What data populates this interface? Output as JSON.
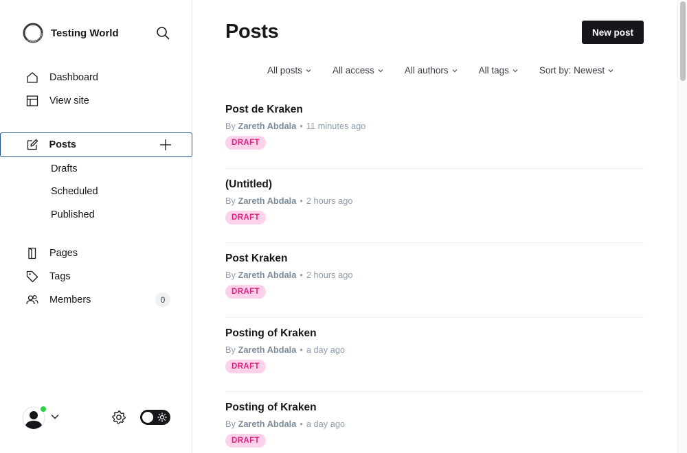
{
  "brand": {
    "name": "Testing World",
    "logo_icon": "ring-logo-icon"
  },
  "sidebar": {
    "top_items": [
      {
        "label": "Dashboard",
        "icon": "home-icon"
      },
      {
        "label": "View site",
        "icon": "layout-icon"
      }
    ],
    "posts": {
      "label": "Posts",
      "icon": "pencil-edit-icon",
      "sub_items": [
        "Drafts",
        "Scheduled",
        "Published"
      ]
    },
    "bottom_items": [
      {
        "label": "Pages",
        "icon": "page-icon"
      },
      {
        "label": "Tags",
        "icon": "tag-icon"
      },
      {
        "label": "Members",
        "icon": "members-icon",
        "count": "0"
      }
    ]
  },
  "main": {
    "title": "Posts",
    "new_post_label": "New post",
    "filters": [
      "All posts",
      "All access",
      "All authors",
      "All tags",
      "Sort by: Newest"
    ],
    "posts": [
      {
        "title": "Post de Kraken",
        "by": "By",
        "author": "Zareth Abdala",
        "time": "11 minutes ago",
        "status": "DRAFT"
      },
      {
        "title": "(Untitled)",
        "by": "By",
        "author": "Zareth Abdala",
        "time": "2 hours ago",
        "status": "DRAFT"
      },
      {
        "title": "Post Kraken",
        "by": "By",
        "author": "Zareth Abdala",
        "time": "2 hours ago",
        "status": "DRAFT"
      },
      {
        "title": "Posting of Kraken",
        "by": "By",
        "author": "Zareth Abdala",
        "time": "a day ago",
        "status": "DRAFT"
      },
      {
        "title": "Posting of Kraken",
        "by": "By",
        "author": "Zareth Abdala",
        "time": "a day ago",
        "status": "DRAFT"
      }
    ]
  },
  "colors": {
    "accent_dark": "#15171a",
    "active_border": "#1f4f8b",
    "draft_bg": "#fbd2e9",
    "draft_text": "#e0227f",
    "online": "#30cf43"
  }
}
